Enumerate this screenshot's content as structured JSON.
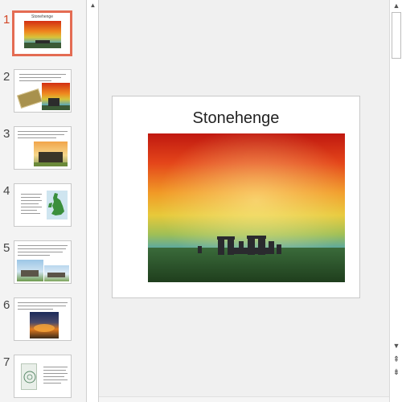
{
  "slide": {
    "title": "Stonehenge"
  },
  "thumbnails": [
    {
      "number": "1",
      "title": "Stonehenge",
      "selected": true
    },
    {
      "number": "2",
      "selected": false
    },
    {
      "number": "3",
      "selected": false
    },
    {
      "number": "4",
      "selected": false
    },
    {
      "number": "5",
      "selected": false
    },
    {
      "number": "6",
      "selected": false
    },
    {
      "number": "7",
      "selected": false
    }
  ],
  "scrollbar": {
    "up_icon": "triangle-up-icon",
    "down_icon": "triangle-down-icon",
    "prev_slide_icon": "double-chevron-up-icon",
    "next_slide_icon": "double-chevron-down-icon"
  },
  "colors": {
    "selection_accent": "#e46c53",
    "selected_number": "#d24726"
  }
}
